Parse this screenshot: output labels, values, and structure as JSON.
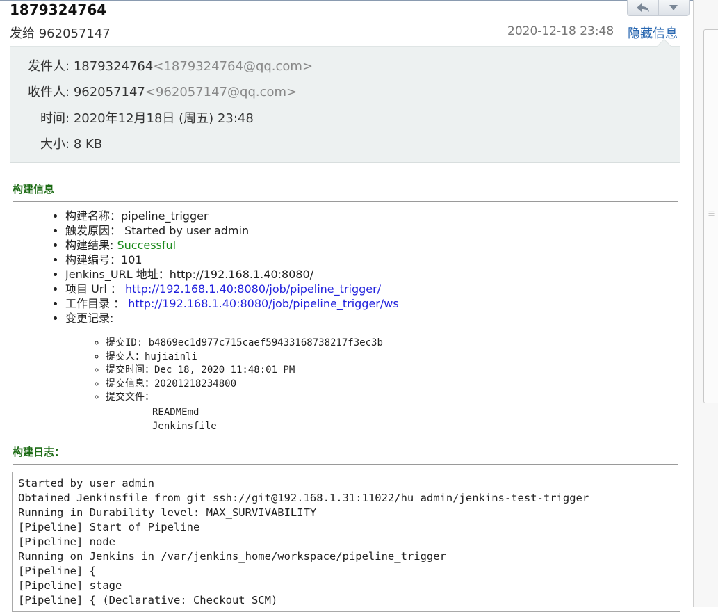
{
  "header": {
    "subject": "1879324764",
    "to_line": "发给 962057147",
    "date": "2020-12-18 23:48",
    "hide_info": "隐藏信息",
    "reply_icon": "reply-icon",
    "more_icon": "chevron-down-icon"
  },
  "details": {
    "from_label": "发件人:",
    "from_name": "1879324764",
    "from_email": "<1879324764@qq.com>",
    "to_label": "收件人:",
    "to_name": "962057147",
    "to_email": "<962057147@qq.com>",
    "time_label": "时间:",
    "time_value": "2020年12月18日 (周五) 23:48",
    "size_label": "大小:",
    "size_value": "8 KB"
  },
  "build_info": {
    "title": "构建信息",
    "name_label": "构建名称：",
    "name_value": "pipeline_trigger",
    "cause_label": "触发原因：",
    "cause_value": " Started by user admin",
    "result_label": "构建结果: ",
    "result_value": "Successful",
    "number_label": "构建编号：",
    "number_value": "101",
    "jenkins_url_label": "Jenkins_URL 地址：",
    "jenkins_url_value": "http://192.168.1.40:8080/",
    "project_url_label": "项目 Url ： ",
    "project_url_value": "http://192.168.1.40:8080/job/pipeline_trigger/",
    "workdir_label": "工作目录 ： ",
    "workdir_value": "http://192.168.1.40:8080/job/pipeline_trigger/ws",
    "changes_label": "变更记录:"
  },
  "commit": {
    "id_label": "提交ID: ",
    "id_value": "b4869ec1d977c715caef59433168738217f3ec3b",
    "author_label": "提交人：",
    "author_value": "hujiainli",
    "time_label": "提交时间：",
    "time_value": "Dec 18, 2020 11:48:01 PM",
    "msg_label": "提交信息：",
    "msg_value": "20201218234800",
    "files_label": "提交文件：",
    "files": [
      "READMEmd",
      "Jenkinsfile"
    ]
  },
  "build_log": {
    "title": "构建日志：",
    "lines": [
      "Started by user admin",
      "Obtained Jenkinsfile from git ssh://git@192.168.1.31:11022/hu_admin/jenkins-test-trigger",
      "Running in Durability level: MAX_SURVIVABILITY",
      "[Pipeline] Start of Pipeline",
      "[Pipeline] node",
      "Running on Jenkins in /var/jenkins_home/workspace/pipeline_trigger",
      "[Pipeline] {",
      "[Pipeline] stage",
      "[Pipeline] { (Declarative: Checkout SCM)"
    ]
  }
}
